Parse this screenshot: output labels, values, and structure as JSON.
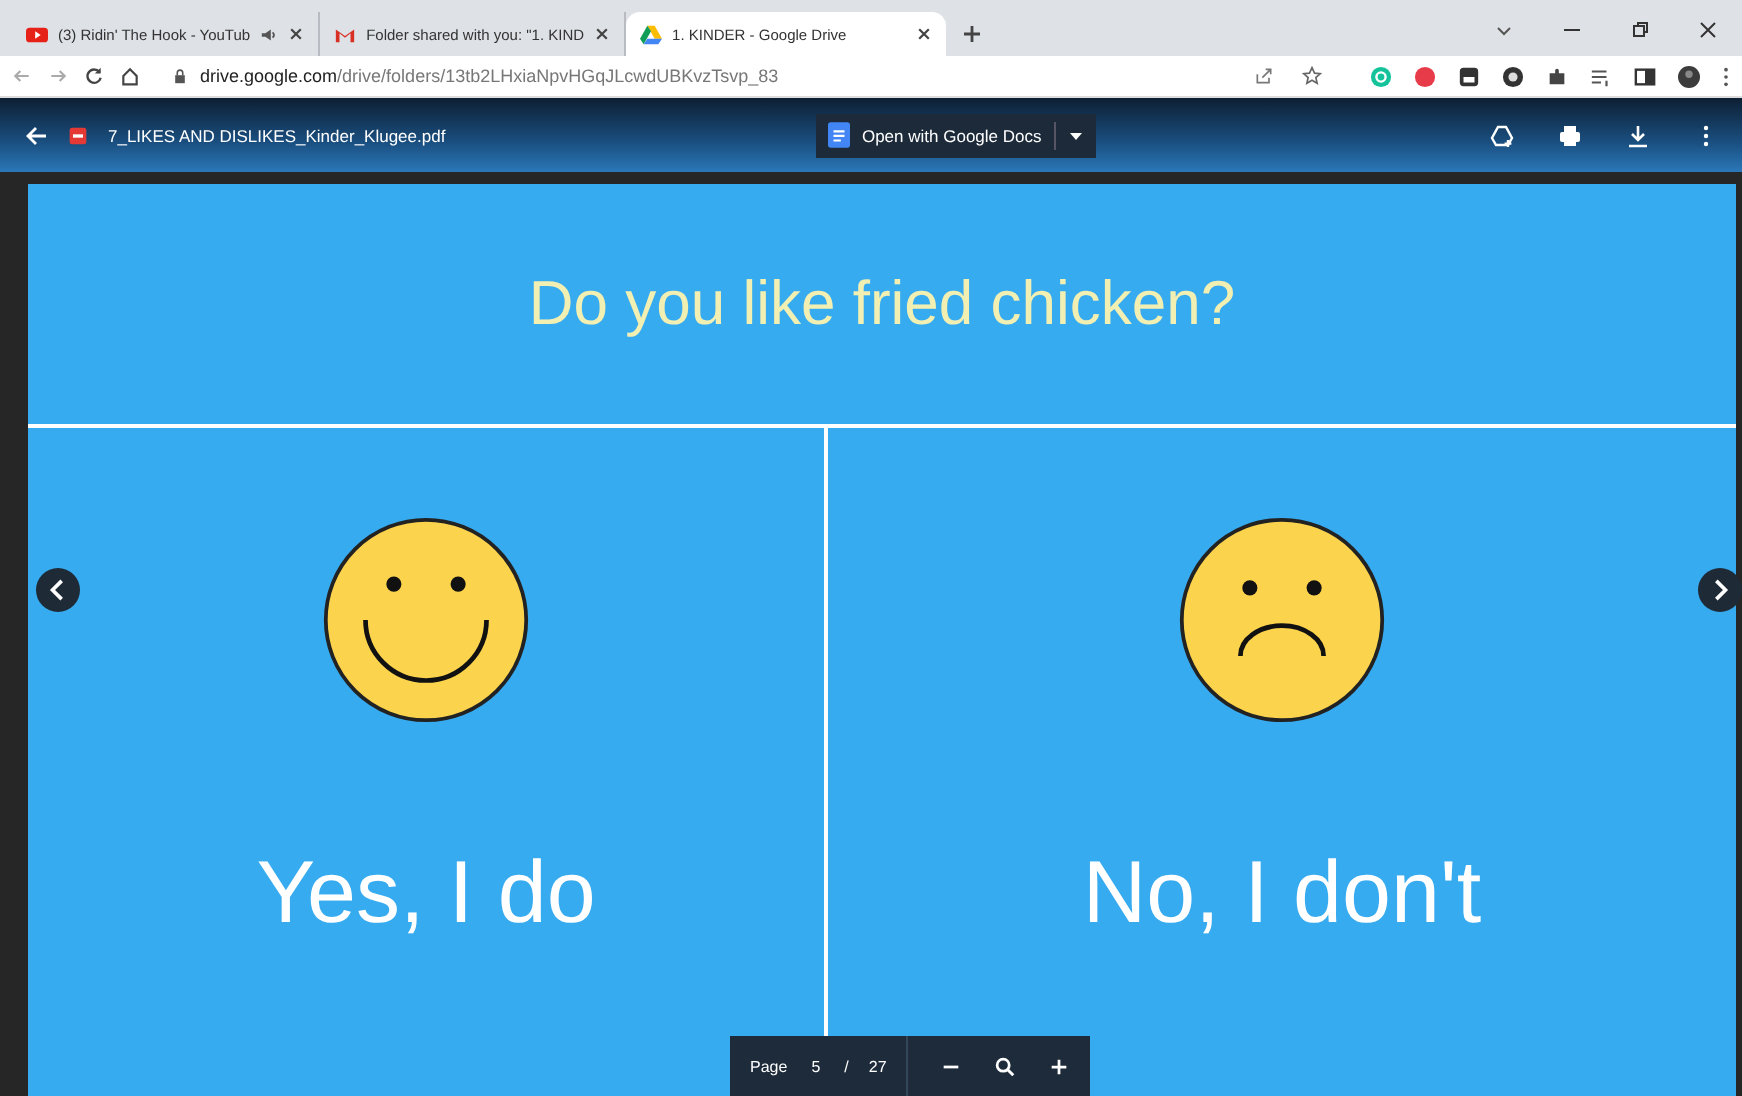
{
  "tabs": [
    {
      "kind": "youtube",
      "title": "(3) Ridin' The Hook - YouTub",
      "audio": true,
      "selected": false
    },
    {
      "kind": "gmail",
      "title": "Folder shared with you: \"1. KIND",
      "audio": false,
      "selected": false
    },
    {
      "kind": "drive",
      "title": "1. KINDER - Google Drive",
      "audio": false,
      "selected": true
    }
  ],
  "address_bar": {
    "url_host": "drive.google.com",
    "url_path": "/drive/folders/13tb2LHxiaNpvHGqJLcwdUBKvzTsvp_83"
  },
  "viewer": {
    "file_name": "7_LIKES AND DISLIKES_Kinder_Klugee.pdf",
    "open_button": "Open with Google Docs"
  },
  "slide": {
    "question": "Do you like fried chicken?",
    "answers": [
      {
        "kind": "happy",
        "label": "Yes, I do"
      },
      {
        "kind": "sad",
        "label": "No, I don't"
      }
    ]
  },
  "page_control": {
    "label": "Page",
    "current": "5",
    "separator": "/",
    "total": "27"
  }
}
